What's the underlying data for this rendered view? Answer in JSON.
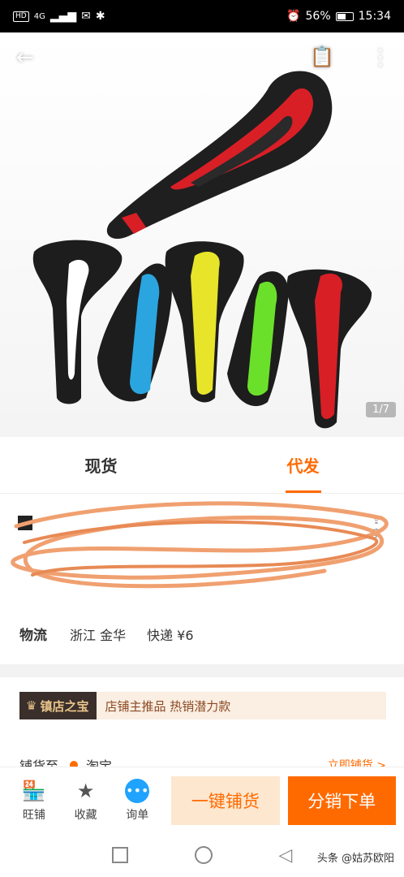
{
  "status_bar": {
    "network": "HD",
    "signal": "4G",
    "battery": "56%",
    "time": "15:34"
  },
  "hero": {
    "counter": "1/7"
  },
  "tabs": [
    {
      "label": "现货"
    },
    {
      "label": "代发"
    }
  ],
  "info": {
    "share_label": "享",
    "logistics": {
      "label": "物流",
      "location": "浙江 金华",
      "shipping": "快递 ¥6"
    }
  },
  "treasure": {
    "badge": "镇店之宝",
    "description": "店铺主推品 热销潜力款",
    "row_label": "铺货至",
    "row_value": "淘宝",
    "row_link": "立即铺货 >"
  },
  "actions": [
    {
      "label": "旺铺"
    },
    {
      "label": "收藏"
    },
    {
      "label": "询单"
    }
  ],
  "buttons": {
    "one_click": "一键铺货",
    "order": "分销下单"
  },
  "watermark": "头条 @姑苏欧阳",
  "colors": {
    "accent": "#ff6a00",
    "price": "#e8402b"
  }
}
